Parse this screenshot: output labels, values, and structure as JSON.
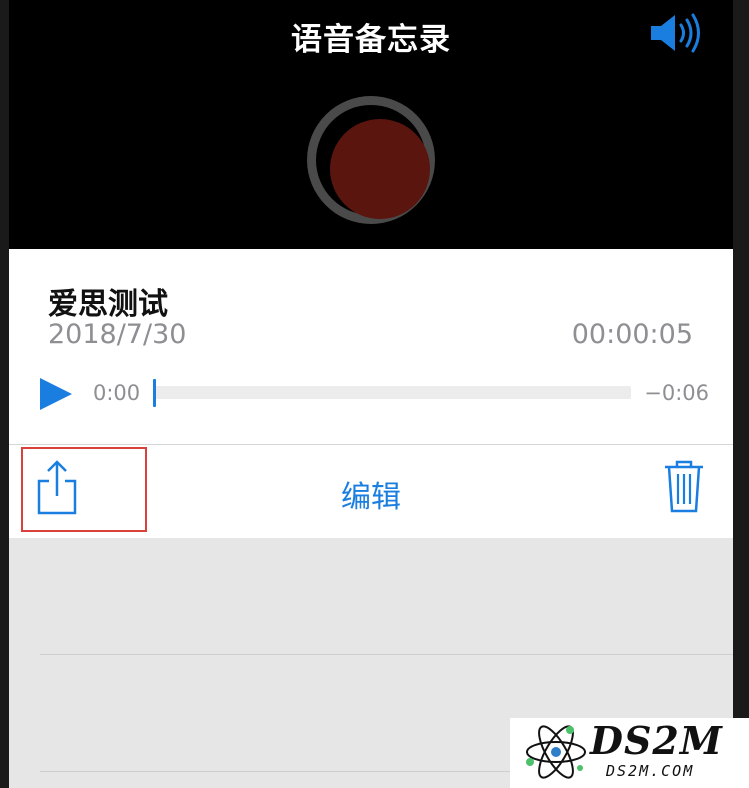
{
  "header": {
    "title": "语音备忘录",
    "speaker_icon": "speaker-volume-icon",
    "record_button_color": "#5a150f"
  },
  "recording": {
    "title": "爱思测试",
    "date": "2018/7/30",
    "duration": "00:00:05",
    "elapsed": "0:00",
    "remaining": "−0:06",
    "progress": 0
  },
  "actions": {
    "share_icon": "share-icon",
    "edit_label": "编辑",
    "trash_icon": "trash-icon",
    "accent_color": "#1a7ee0",
    "highlight_color": "#d9423b"
  },
  "watermark": {
    "text": "DS2M",
    "subtext": "DS2M.COM"
  }
}
